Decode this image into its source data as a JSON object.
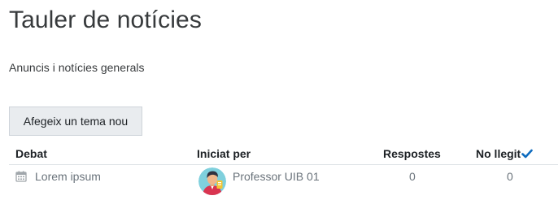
{
  "page": {
    "title": "Tauler de notícies",
    "intro": "Anuncis i notícies generals"
  },
  "actions": {
    "add_topic_label": "Afegeix un tema nou"
  },
  "table": {
    "headers": {
      "discussion": "Debat",
      "started_by": "Iniciat per",
      "replies": "Respostes",
      "unread": "No llegit"
    },
    "rows": [
      {
        "discussion": "Lorem ipsum",
        "started_by": "Professor UIB 01",
        "replies": "0",
        "unread": "0",
        "icon": "calendar-icon",
        "avatar": "user-avatar"
      }
    ]
  },
  "icons": {
    "check": "check-icon",
    "calendar": "calendar-icon"
  },
  "colors": {
    "text": "#373a3c",
    "muted": "#6a737b",
    "button_bg": "#e9ecef",
    "check": "#0f6cbf",
    "border": "#dee2e6"
  }
}
